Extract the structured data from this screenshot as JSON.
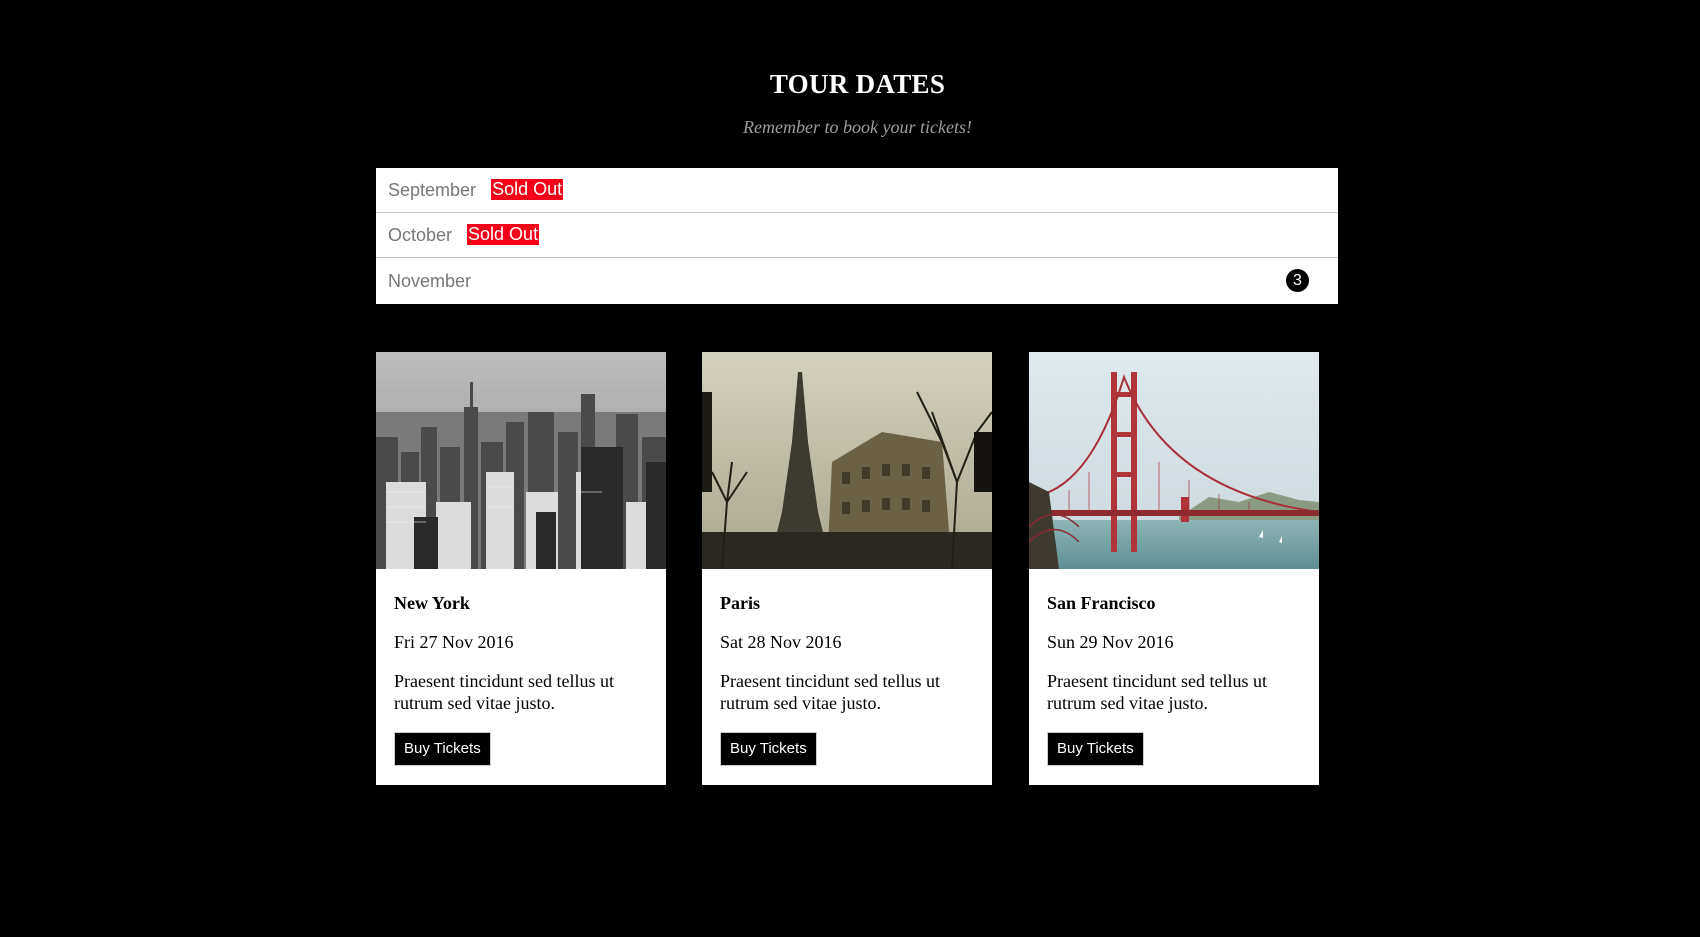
{
  "header": {
    "title": "TOUR DATES",
    "subtitle": "Remember to book your tickets!"
  },
  "months": [
    {
      "label": "September",
      "badge": "Sold Out"
    },
    {
      "label": "October",
      "badge": "Sold Out"
    },
    {
      "label": "November",
      "count": "3"
    }
  ],
  "cards": [
    {
      "city": "New York",
      "date": "Fri 27 Nov 2016",
      "description": "Praesent tincidunt sed tellus ut rutrum sed vitae justo.",
      "button": "Buy Tickets",
      "image": "new-york-skyline"
    },
    {
      "city": "Paris",
      "date": "Sat 28 Nov 2016",
      "description": "Praesent tincidunt sed tellus ut rutrum sed vitae justo.",
      "button": "Buy Tickets",
      "image": "paris-eiffel-tower"
    },
    {
      "city": "San Francisco",
      "date": "Sun 29 Nov 2016",
      "description": "Praesent tincidunt sed tellus ut rutrum sed vitae justo.",
      "button": "Buy Tickets",
      "image": "golden-gate-bridge"
    }
  ],
  "colors": {
    "background": "#000000",
    "sold_out": "#f40019",
    "subtitle": "#9e9e9e",
    "month_text": "#777777"
  }
}
